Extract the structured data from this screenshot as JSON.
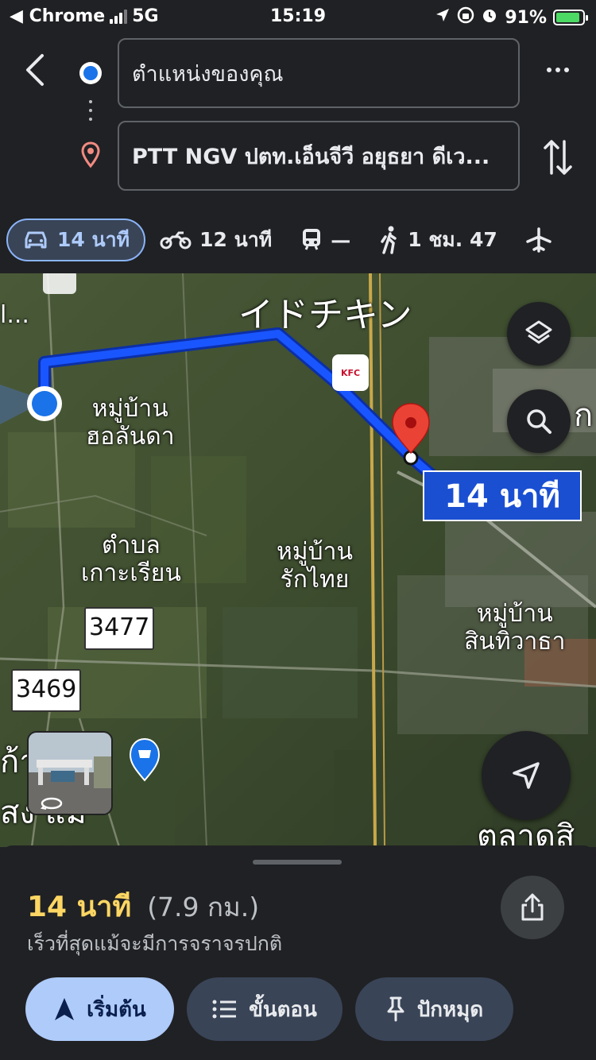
{
  "status_bar": {
    "back_app": "◀ Chrome",
    "network": "5G",
    "time": "15:19",
    "battery": "91%",
    "battery_level": 0.91
  },
  "directions": {
    "origin": "ตำแหน่งของคุณ",
    "destination": "PTT NGV ปตท.เอ็นจีวี อยุธยา ดีเว..."
  },
  "modes": [
    {
      "icon": "car-icon",
      "label": "14 นาที"
    },
    {
      "icon": "motorcycle-icon",
      "label": "12 นาที"
    },
    {
      "icon": "transit-icon",
      "label": "—"
    },
    {
      "icon": "walk-icon",
      "label": "1 ชม. 47"
    },
    {
      "icon": "flight-icon",
      "label": ""
    }
  ],
  "map": {
    "labels": {
      "poi_chicken": "イドチキン",
      "village_holanda": "หมู่บ้าน\nฮอลันดา",
      "tambon_kohrian": "ตำบล\nเกาะเรียน",
      "village_rakthai": "หมู่บ้าน\nรักไทย",
      "village_sinthiwa": "หมู่บ้าน\nสินทิวาธา",
      "left_edge_top": "l...",
      "left_edge_bottom_1": "ก้า",
      "left_edge_bottom_2": "สง แม",
      "right_edge_top": "ก",
      "market": "ตลาดสิ",
      "kfc": "KFC"
    },
    "road_signs": [
      "3477",
      "3469"
    ],
    "eta_callout": "14 นาที",
    "route_color": "#1a56ff"
  },
  "sheet": {
    "eta": "14 นาที",
    "distance": "(7.9 กม.)",
    "note": "เร็วที่สุดแม้จะมีการจราจรปกติ",
    "start_label": "เริ่มต้น",
    "steps_label": "ขั้นตอน",
    "pin_label": "ปักหมุด"
  }
}
